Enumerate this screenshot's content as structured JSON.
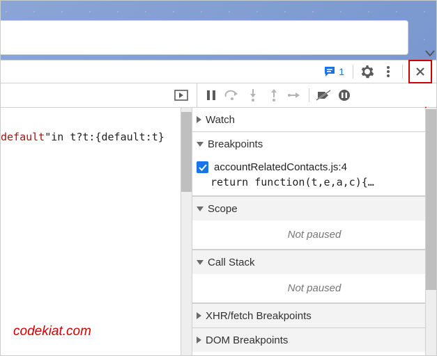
{
  "header": {
    "messages_count": "1"
  },
  "code": {
    "keyword": "default",
    "rest": "\"in t?t:{default:t}"
  },
  "panel": {
    "watch": "Watch",
    "breakpoints": {
      "title": "Breakpoints",
      "item_file": "accountRelatedContacts.js:4",
      "item_code": "return function(t,e,a,c){…"
    },
    "scope": {
      "title": "Scope",
      "not_paused": "Not paused"
    },
    "callstack": {
      "title": "Call Stack",
      "not_paused": "Not paused"
    },
    "xhr": "XHR/fetch Breakpoints",
    "dom": "DOM Breakpoints"
  },
  "watermark": "codekiat.com"
}
